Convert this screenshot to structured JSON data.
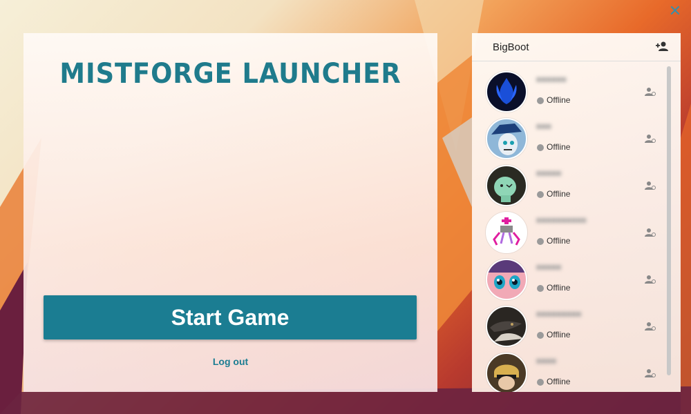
{
  "window": {
    "close_label": "✕"
  },
  "main": {
    "title": "MISTFORGE LAUNCHER",
    "start_label": "Start Game",
    "logout_label": "Log out"
  },
  "sidebar": {
    "username": "BigBoot",
    "add_friend_icon": "add-person-icon",
    "friends": [
      {
        "status": "Offline",
        "avatar": "blue-flame-avatar"
      },
      {
        "status": "Offline",
        "avatar": "hat-character-avatar"
      },
      {
        "status": "Offline",
        "avatar": "plush-toy-avatar"
      },
      {
        "status": "Offline",
        "avatar": "pixel-robot-avatar"
      },
      {
        "status": "Offline",
        "avatar": "anime-eyes-avatar"
      },
      {
        "status": "Offline",
        "avatar": "dragon-avatar"
      },
      {
        "status": "Offline",
        "avatar": "costume-character-avatar"
      }
    ]
  },
  "colors": {
    "accent": "#1b7d92",
    "status_offline": "#9a9a9a"
  }
}
